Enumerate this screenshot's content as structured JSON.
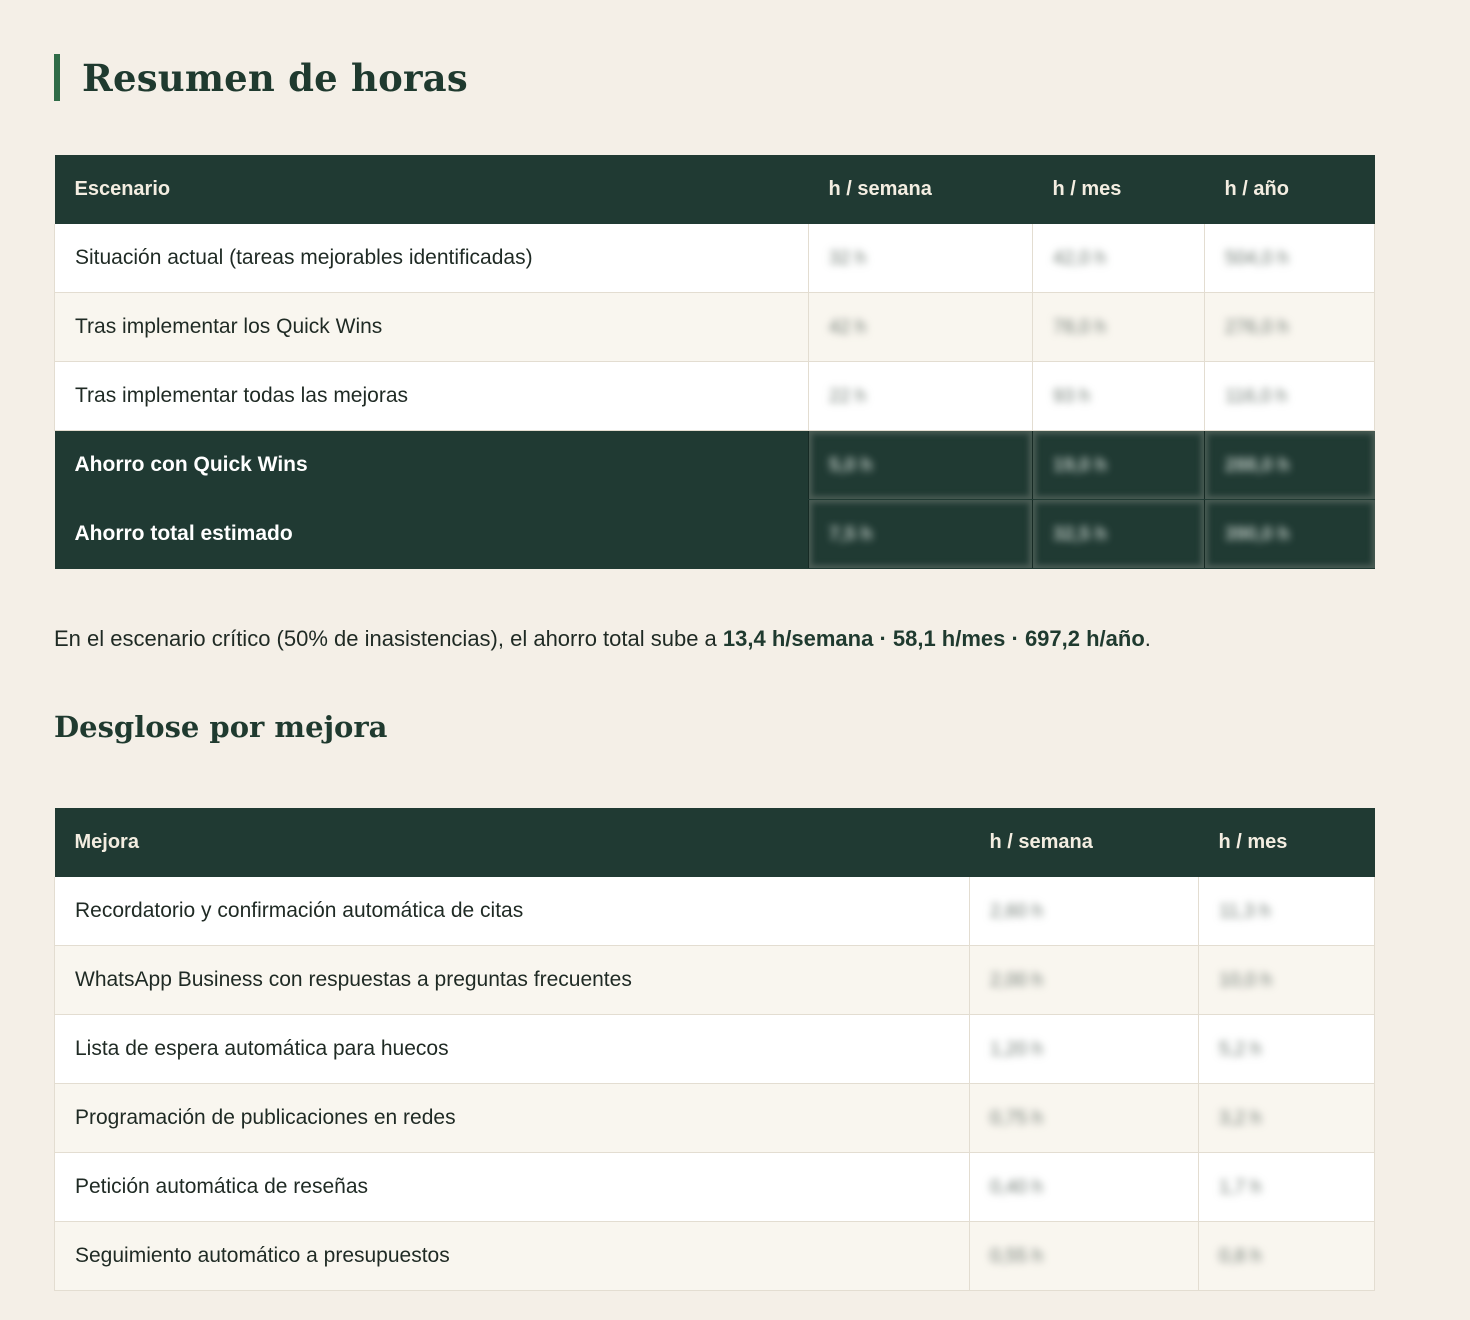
{
  "summary": {
    "title": "Resumen de horas",
    "columns": [
      "Escenario",
      "h / semana",
      "h / mes",
      "h / año"
    ],
    "rows": [
      {
        "label": "Situación actual (tareas mejorables identificadas)",
        "week": "32 h",
        "month": "42,0 h",
        "year": "504,0 h"
      },
      {
        "label": "Tras implementar los Quick Wins",
        "week": "42 h",
        "month": "78,0 h",
        "year": "276,0 h"
      },
      {
        "label": "Tras implementar todas las mejoras",
        "week": "22 h",
        "month": "93 h",
        "year": "116,0 h"
      }
    ],
    "savings": [
      {
        "label": "Ahorro con Quick Wins",
        "week": "5,0 h",
        "month": "19,0 h",
        "year": "288,0 h"
      },
      {
        "label": "Ahorro total estimado",
        "week": "7,5 h",
        "month": "32,5 h",
        "year": "390,0 h"
      }
    ]
  },
  "note": {
    "prefix": "En el escenario crítico (50% de inasistencias), el ahorro total sube a ",
    "highlight": "13,4 h/semana · 58,1 h/mes · 697,2 h/año",
    "suffix": "."
  },
  "breakdown": {
    "title": "Desglose por mejora",
    "columns": [
      "Mejora",
      "h / semana",
      "h / mes"
    ],
    "rows": [
      {
        "label": "Recordatorio y confirmación automática de citas",
        "week": "2,60 h",
        "month": "11,3 h"
      },
      {
        "label": "WhatsApp Business con respuestas a preguntas frecuentes",
        "week": "2,00 h",
        "month": "10,0 h"
      },
      {
        "label": "Lista de espera automática para huecos",
        "week": "1,20 h",
        "month": "5,2 h"
      },
      {
        "label": "Programación de publicaciones en redes",
        "week": "0,75 h",
        "month": "3,2 h"
      },
      {
        "label": "Petición automática de reseñas",
        "week": "0,40 h",
        "month": "1,7 h"
      },
      {
        "label": "Seguimiento automático a presupuestos",
        "week": "0,55 h",
        "month": "0,8 h"
      }
    ]
  }
}
